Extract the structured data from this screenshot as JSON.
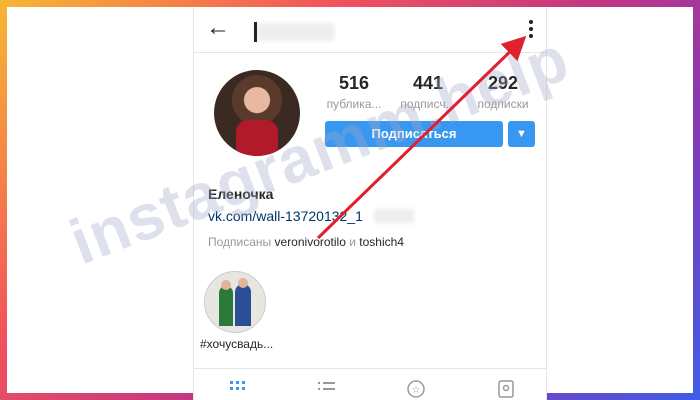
{
  "profile": {
    "display_name": "Еленочка",
    "link": "vk.com/wall-137201",
    "link_tail": "32_1",
    "followed_prefix": "Подписаны",
    "followed_user1": "veroni",
    "followed_user1_b": "vorotilo",
    "followed_and": "и",
    "followed_user2": "toshich4"
  },
  "stats": [
    {
      "value": "516",
      "label": "публика..."
    },
    {
      "value": "441",
      "label": "подписч..."
    },
    {
      "value": "292",
      "label": "подписки"
    }
  ],
  "actions": {
    "subscribe_label": "Подписаться",
    "dropdown_glyph": "▼"
  },
  "highlight": {
    "label": "#хочусвадь..."
  },
  "watermark": "instagramm.help",
  "icons": [
    "back-arrow-icon",
    "more-vertical-icon",
    "grid-icon",
    "list-icon",
    "star-icon",
    "tagged-icon"
  ],
  "colors": {
    "accent": "#3897f0",
    "arrow": "#e0202e"
  }
}
